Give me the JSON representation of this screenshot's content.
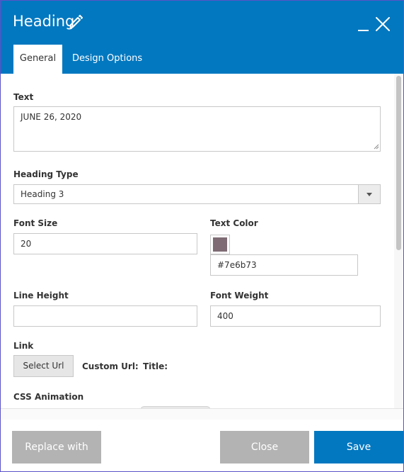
{
  "dialog": {
    "title": "Heading",
    "tabs": [
      {
        "label": "General",
        "active": true
      },
      {
        "label": "Design Options",
        "active": false
      }
    ],
    "header_color": "#0278c0"
  },
  "form": {
    "text": {
      "label": "Text",
      "value": "JUNE 26, 2020"
    },
    "heading_type": {
      "label": "Heading Type",
      "value": "Heading 3"
    },
    "font_size": {
      "label": "Font Size",
      "value": "20"
    },
    "text_color": {
      "label": "Text Color",
      "value": "#7e6b73",
      "swatch": "#7e6b73"
    },
    "line_height": {
      "label": "Line Height",
      "value": ""
    },
    "font_weight": {
      "label": "Font Weight",
      "value": "400"
    },
    "link": {
      "label": "Link",
      "select_url_label": "Select Url",
      "custom_url_label": "Custom Url:",
      "title_label": "Title:"
    },
    "css_animation": {
      "label": "CSS Animation"
    }
  },
  "footer": {
    "replace_label": "Replace with",
    "close_label": "Close",
    "save_label": "Save"
  }
}
